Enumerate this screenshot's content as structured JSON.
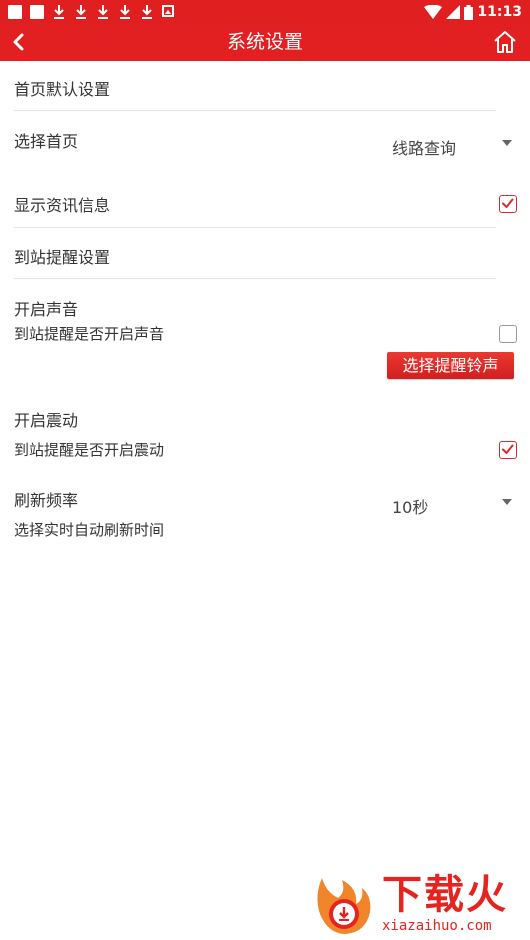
{
  "status_bar": {
    "time": "11:13",
    "notification_icons": [
      "square-icon",
      "square-icon",
      "download-icon",
      "download-icon",
      "download-icon",
      "download-icon",
      "download-icon",
      "image-icon"
    ]
  },
  "app_bar": {
    "title": "系统设置",
    "back_icon": "back-arrow-icon",
    "home_icon": "home-icon"
  },
  "sections": {
    "home_default": "首页默认设置",
    "arrival_reminder": "到站提醒设置"
  },
  "settings": {
    "select_home": {
      "label": "选择首页",
      "value": "线路查询"
    },
    "show_news": {
      "label": "显示资讯信息",
      "checked": true
    },
    "sound": {
      "label": "开启声音",
      "description": "到站提醒是否开启声音",
      "checked": false,
      "ringtone_button": "选择提醒铃声"
    },
    "vibrate": {
      "label": "开启震动",
      "description": "到站提醒是否开启震动",
      "checked": true
    },
    "refresh": {
      "label": "刷新频率",
      "description": "选择实时自动刷新时间",
      "value": "10秒"
    }
  },
  "watermark": {
    "brand": "下载火",
    "url": "xiazaihuo.com"
  },
  "colors": {
    "primary_red": "#e21f21",
    "checkbox_red": "#d92b2b"
  }
}
